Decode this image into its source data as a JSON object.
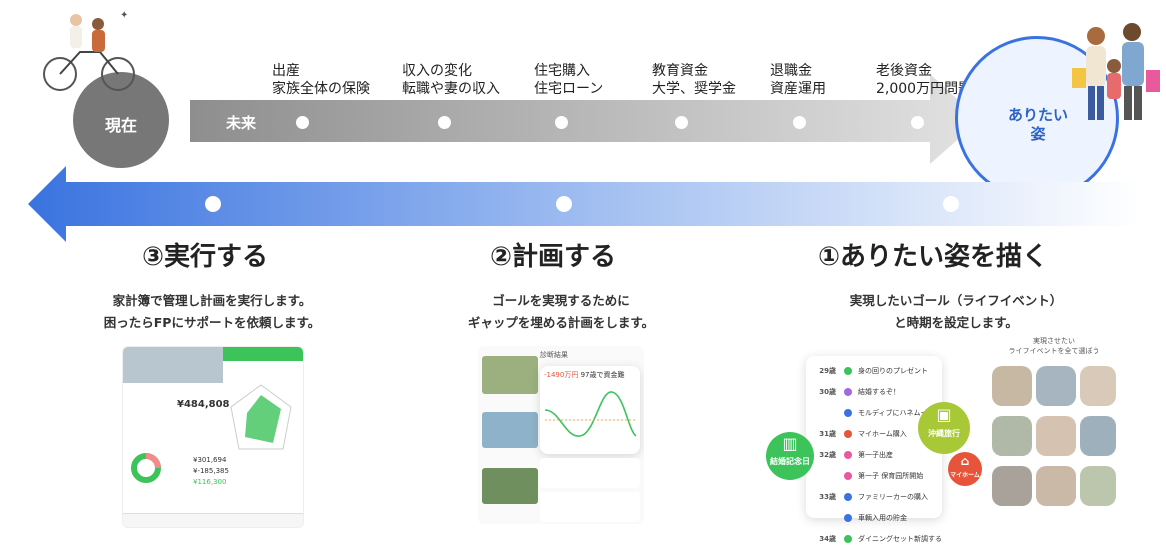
{
  "timeline": {
    "now_label": "現在",
    "future_label": "未来",
    "goal_label": "ありたい姿",
    "milestones": [
      {
        "line1": "出産",
        "line2": "家族全体の保険"
      },
      {
        "line1": "収入の変化",
        "line2": "転職や妻の収入"
      },
      {
        "line1": "住宅購入",
        "line2": "住宅ローン"
      },
      {
        "line1": "教育資金",
        "line2": "大学、奨学金"
      },
      {
        "line1": "退職金",
        "line2": "資産運用"
      },
      {
        "line1": "老後資金",
        "line2": "2,000万円問題"
      }
    ]
  },
  "colors": {
    "grey_arrow": "#c8c8c8",
    "blue_arrow": "#3a73e0",
    "now_circle": "#777777",
    "goal_border": "#3a73e0",
    "accent_green": "#3cc35a"
  },
  "steps": [
    {
      "title": "③実行する",
      "desc1": "家計簿で管理し計画を実行します。",
      "desc2": "困ったらFPにサポートを依頼します。"
    },
    {
      "title": "②計画する",
      "desc1": "ゴールを実現するために",
      "desc2": "ギャップを埋める計画をします。"
    },
    {
      "title": "①ありたい姿を描く",
      "desc1": "実現したいゴール（ライフイベント）",
      "desc2": "と時期を設定します。"
    }
  ],
  "app_budget": {
    "amount": "¥484,808",
    "values": [
      "¥301,694",
      "¥-185,385",
      "¥116,300"
    ]
  },
  "app_plan": {
    "tab": "診断結果",
    "gap": "-1490万円",
    "gap_note": "97歳で資金難"
  },
  "app_events": {
    "header": "実現させたい",
    "header2": "ライフイベントを全て選ぼう",
    "rows": [
      {
        "age": "29歳",
        "text": "身の回りのプレゼント"
      },
      {
        "age": "30歳",
        "text": "結婚するぞ！"
      },
      {
        "age": "",
        "text": "モルディブにハネムーン"
      },
      {
        "age": "31歳",
        "text": "マイホーム購入"
      },
      {
        "age": "32歳",
        "text": "第一子出産"
      },
      {
        "age": "",
        "text": "第一子 保育园所開始"
      },
      {
        "age": "33歳",
        "text": "ファミリーカーの購入"
      },
      {
        "age": "",
        "text": "車輌入用の貯金"
      },
      {
        "age": "34歳",
        "text": "ダイニングセット新調する"
      }
    ],
    "badges": [
      "結婚記念日",
      "沖縄旅行",
      "マイホーム"
    ]
  }
}
